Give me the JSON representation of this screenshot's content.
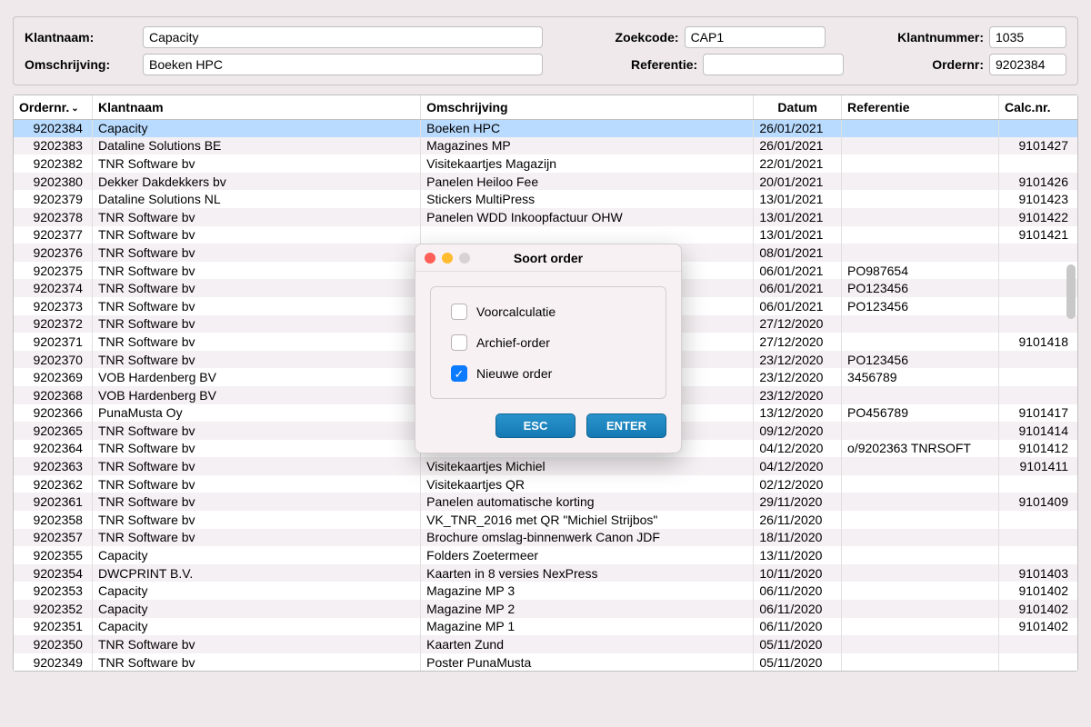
{
  "form": {
    "klantnaam_label": "Klantnaam:",
    "klantnaam_value": "Capacity",
    "zoekcode_label": "Zoekcode:",
    "zoekcode_value": "CAP1",
    "klantnummer_label": "Klantnummer:",
    "klantnummer_value": "1035",
    "omschrijving_label": "Omschrijving:",
    "omschrijving_value": "Boeken HPC",
    "referentie_label": "Referentie:",
    "referentie_value": "",
    "ordernr_label": "Ordernr:",
    "ordernr_value": "9202384"
  },
  "table": {
    "headers": {
      "ordernr": "Ordernr.",
      "klantnaam": "Klantnaam",
      "omschrijving": "Omschrijving",
      "datum": "Datum",
      "referentie": "Referentie",
      "calcnr": "Calc.nr."
    },
    "rows": [
      {
        "ordernr": "9202384",
        "klant": "Capacity",
        "omschr": "Boeken HPC",
        "datum": "26/01/2021",
        "ref": "",
        "calc": "",
        "selected": true
      },
      {
        "ordernr": "9202383",
        "klant": "Dataline Solutions BE",
        "omschr": "Magazines MP",
        "datum": "26/01/2021",
        "ref": "",
        "calc": "9101427"
      },
      {
        "ordernr": "9202382",
        "klant": "TNR Software bv",
        "omschr": "Visitekaartjes Magazijn",
        "datum": "22/01/2021",
        "ref": "",
        "calc": ""
      },
      {
        "ordernr": "9202380",
        "klant": "Dekker Dakdekkers bv",
        "omschr": "Panelen Heiloo Fee",
        "datum": "20/01/2021",
        "ref": "",
        "calc": "9101426"
      },
      {
        "ordernr": "9202379",
        "klant": "Dataline Solutions NL",
        "omschr": "Stickers MultiPress",
        "datum": "13/01/2021",
        "ref": "",
        "calc": "9101423"
      },
      {
        "ordernr": "9202378",
        "klant": "TNR Software bv",
        "omschr": "Panelen WDD Inkoopfactuur OHW",
        "datum": "13/01/2021",
        "ref": "",
        "calc": "9101422"
      },
      {
        "ordernr": "9202377",
        "klant": "TNR Software bv",
        "omschr": "",
        "datum": "13/01/2021",
        "ref": "",
        "calc": "9101421"
      },
      {
        "ordernr": "9202376",
        "klant": "TNR Software bv",
        "omschr": "",
        "datum": "08/01/2021",
        "ref": "",
        "calc": ""
      },
      {
        "ordernr": "9202375",
        "klant": "TNR Software bv",
        "omschr": "",
        "datum": "06/01/2021",
        "ref": "PO987654",
        "calc": ""
      },
      {
        "ordernr": "9202374",
        "klant": "TNR Software bv",
        "omschr": "",
        "datum": "06/01/2021",
        "ref": "PO123456",
        "calc": ""
      },
      {
        "ordernr": "9202373",
        "klant": "TNR Software bv",
        "omschr": "",
        "datum": "06/01/2021",
        "ref": "PO123456",
        "calc": ""
      },
      {
        "ordernr": "9202372",
        "klant": "TNR Software bv",
        "omschr": "",
        "datum": "27/12/2020",
        "ref": "",
        "calc": ""
      },
      {
        "ordernr": "9202371",
        "klant": "TNR Software bv",
        "omschr": "",
        "datum": "27/12/2020",
        "ref": "",
        "calc": "9101418"
      },
      {
        "ordernr": "9202370",
        "klant": "TNR Software bv",
        "omschr": "",
        "datum": "23/12/2020",
        "ref": "PO123456",
        "calc": ""
      },
      {
        "ordernr": "9202369",
        "klant": "VOB Hardenberg BV",
        "omschr": "",
        "datum": "23/12/2020",
        "ref": "3456789",
        "calc": ""
      },
      {
        "ordernr": "9202368",
        "klant": "VOB Hardenberg BV",
        "omschr": "",
        "datum": "23/12/2020",
        "ref": "",
        "calc": ""
      },
      {
        "ordernr": "9202366",
        "klant": "PunaMusta Oy",
        "omschr": "",
        "datum": "13/12/2020",
        "ref": "PO456789",
        "calc": "9101417"
      },
      {
        "ordernr": "9202365",
        "klant": "TNR Software bv",
        "omschr": "",
        "datum": "09/12/2020",
        "ref": "",
        "calc": "9101414"
      },
      {
        "ordernr": "9202364",
        "klant": "TNR Software bv",
        "omschr": "",
        "datum": "04/12/2020",
        "ref": "o/9202363 TNRSOFT",
        "calc": "9101412"
      },
      {
        "ordernr": "9202363",
        "klant": "TNR Software bv",
        "omschr": "Visitekaartjes Michiel",
        "datum": "04/12/2020",
        "ref": "",
        "calc": "9101411"
      },
      {
        "ordernr": "9202362",
        "klant": "TNR Software bv",
        "omschr": "Visitekaartjes QR",
        "datum": "02/12/2020",
        "ref": "",
        "calc": ""
      },
      {
        "ordernr": "9202361",
        "klant": "TNR Software bv",
        "omschr": "Panelen automatische korting",
        "datum": "29/11/2020",
        "ref": "",
        "calc": "9101409"
      },
      {
        "ordernr": "9202358",
        "klant": "TNR Software bv",
        "omschr": "VK_TNR_2016 met QR \"Michiel Strijbos\"",
        "datum": "26/11/2020",
        "ref": "",
        "calc": ""
      },
      {
        "ordernr": "9202357",
        "klant": "TNR Software bv",
        "omschr": "Brochure omslag-binnenwerk Canon JDF",
        "datum": "18/11/2020",
        "ref": "",
        "calc": ""
      },
      {
        "ordernr": "9202355",
        "klant": "Capacity",
        "omschr": "Folders Zoetermeer",
        "datum": "13/11/2020",
        "ref": "",
        "calc": ""
      },
      {
        "ordernr": "9202354",
        "klant": "DWCPRINT B.V.",
        "omschr": "Kaarten in 8 versies NexPress",
        "datum": "10/11/2020",
        "ref": "",
        "calc": "9101403"
      },
      {
        "ordernr": "9202353",
        "klant": "Capacity",
        "omschr": "Magazine MP 3",
        "datum": "06/11/2020",
        "ref": "",
        "calc": "9101402"
      },
      {
        "ordernr": "9202352",
        "klant": "Capacity",
        "omschr": "Magazine MP 2",
        "datum": "06/11/2020",
        "ref": "",
        "calc": "9101402"
      },
      {
        "ordernr": "9202351",
        "klant": "Capacity",
        "omschr": "Magazine MP 1",
        "datum": "06/11/2020",
        "ref": "",
        "calc": "9101402"
      },
      {
        "ordernr": "9202350",
        "klant": "TNR Software bv",
        "omschr": "Kaarten Zund",
        "datum": "05/11/2020",
        "ref": "",
        "calc": ""
      },
      {
        "ordernr": "9202349",
        "klant": "TNR Software bv",
        "omschr": "Poster PunaMusta",
        "datum": "05/11/2020",
        "ref": "",
        "calc": ""
      }
    ]
  },
  "modal": {
    "title": "Soort order",
    "options": [
      {
        "label": "Voorcalculatie",
        "checked": false
      },
      {
        "label": "Archief-order",
        "checked": false
      },
      {
        "label": "Nieuwe order",
        "checked": true
      }
    ],
    "esc_label": "ESC",
    "enter_label": "ENTER"
  }
}
